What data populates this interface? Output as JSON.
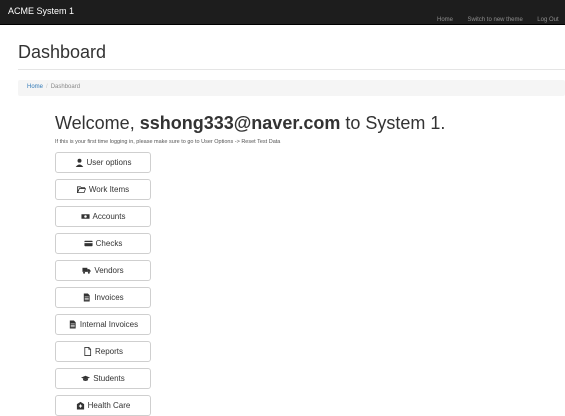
{
  "navbar": {
    "brand": "ACME System 1",
    "links": [
      "Home",
      "Switch to new theme",
      "Log Out"
    ]
  },
  "page": {
    "title": "Dashboard"
  },
  "breadcrumb": {
    "home": "Home",
    "separator": "/",
    "current": "Dashboard"
  },
  "welcome": {
    "prefix": "Welcome,",
    "user": "sshong333@naver.com",
    "suffix": "to System 1.",
    "hint": "If this is your first time logging in, please make sure to go to User Options -> Reset Test Data"
  },
  "menu": [
    {
      "label": "User options",
      "icon": "user-icon"
    },
    {
      "label": "Work Items",
      "icon": "folder-open-icon"
    },
    {
      "label": "Accounts",
      "icon": "money-icon"
    },
    {
      "label": "Checks",
      "icon": "credit-card-icon"
    },
    {
      "label": "Vendors",
      "icon": "truck-icon"
    },
    {
      "label": "Invoices",
      "icon": "file-text-icon"
    },
    {
      "label": "Internal Invoices",
      "icon": "file-text-icon"
    },
    {
      "label": "Reports",
      "icon": "file-icon"
    },
    {
      "label": "Students",
      "icon": "graduation-cap-icon"
    },
    {
      "label": "Health Care",
      "icon": "hospital-icon"
    }
  ],
  "colors": {
    "navbar": "#1d1d1d",
    "link": "#337ab7",
    "breadcrumb_bg": "#f5f5f5"
  }
}
